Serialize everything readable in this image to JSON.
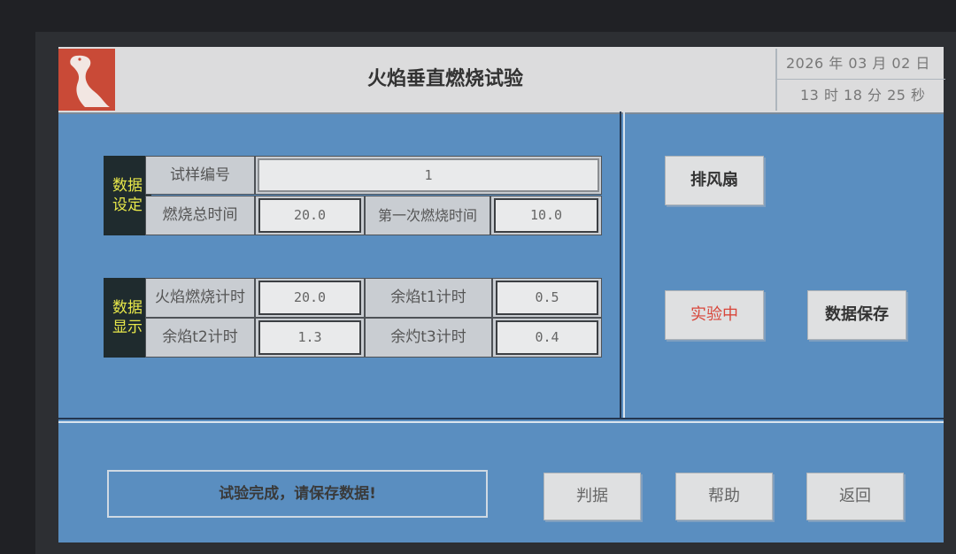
{
  "header": {
    "title": "火焰垂直燃烧试验",
    "date": "2026 年 03 月 02 日",
    "time": "13 时 18 分 25 秒"
  },
  "settings": {
    "section_label": "数据设定",
    "sample_no_label": "试样编号",
    "sample_no_value": "1",
    "total_burn_label": "燃烧总时间",
    "total_burn_value": "20.0",
    "first_burn_label": "第一次燃烧时间",
    "first_burn_value": "10.0"
  },
  "display": {
    "section_label": "数据显示",
    "flame_timer_label": "火焰燃烧计时",
    "flame_timer_value": "20.0",
    "t1_label": "余焰t1计时",
    "t1_value": "0.5",
    "t2_label": "余焰t2计时",
    "t2_value": "1.3",
    "t3_label": "余灼t3计时",
    "t3_value": "0.4"
  },
  "controls": {
    "fan_label": "排风扇",
    "running_label": "实验中",
    "save_label": "数据保存"
  },
  "footer": {
    "status_message": "试验完成，请保存数据!",
    "judge_label": "判据",
    "help_label": "帮助",
    "back_label": "返回"
  },
  "colors": {
    "screen_background": "#5a8ec0",
    "section_label_text": "#e8e84a",
    "running_text": "#d8463a",
    "logo_background": "#c94a37"
  }
}
